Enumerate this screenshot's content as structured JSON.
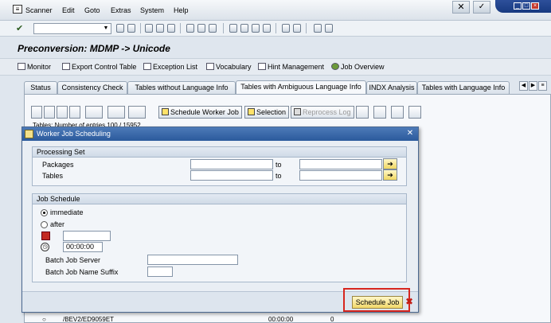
{
  "menu": {
    "items": [
      "Scanner",
      "Edit",
      "Goto",
      "Extras",
      "System",
      "Help"
    ]
  },
  "title": "Preconversion: MDMP -> Unicode",
  "app_toolbar": {
    "buttons": [
      "Monitor",
      "Export Control Table",
      "Exception List",
      "Vocabulary",
      "Hint Management",
      "Job Overview"
    ]
  },
  "tabs": {
    "items": [
      "Status",
      "Consistency Check",
      "Tables without Language Info",
      "Tables with Ambiguous Language Info",
      "INDX Analysis",
      "Tables with Language Info"
    ],
    "active_index": 3
  },
  "grid_toolbar": {
    "schedule_worker_job": "Schedule Worker Job",
    "selection": "Selection",
    "reprocess_log": "Reprocess Log"
  },
  "table_info": "Tables: Number of entries 100  / 15952",
  "background_rows": [
    {
      "c1": "○",
      "c2": "/BEV2/ED9059ET",
      "c3": "00:00:00",
      "c4": "0"
    }
  ],
  "dialog": {
    "title": "Worker Job Scheduling",
    "processing_set": {
      "header": "Processing Set",
      "packages_label": "Packages",
      "tables_label": "Tables",
      "to_label": "to",
      "packages_from": "",
      "packages_to": "",
      "tables_from": "",
      "tables_to": ""
    },
    "job_schedule": {
      "header": "Job Schedule",
      "immediate_label": "immediate",
      "after_label": "after",
      "date_value": "",
      "time_value": "00:00:00",
      "batch_server_label": "Batch Job Server",
      "batch_server_value": "",
      "batch_suffix_label": "Batch Job Name Suffix",
      "batch_suffix_value": ""
    },
    "schedule_button": "Schedule Job"
  },
  "colors": {
    "highlight": "#d7261e",
    "title_bar": "#2b5a9c"
  }
}
